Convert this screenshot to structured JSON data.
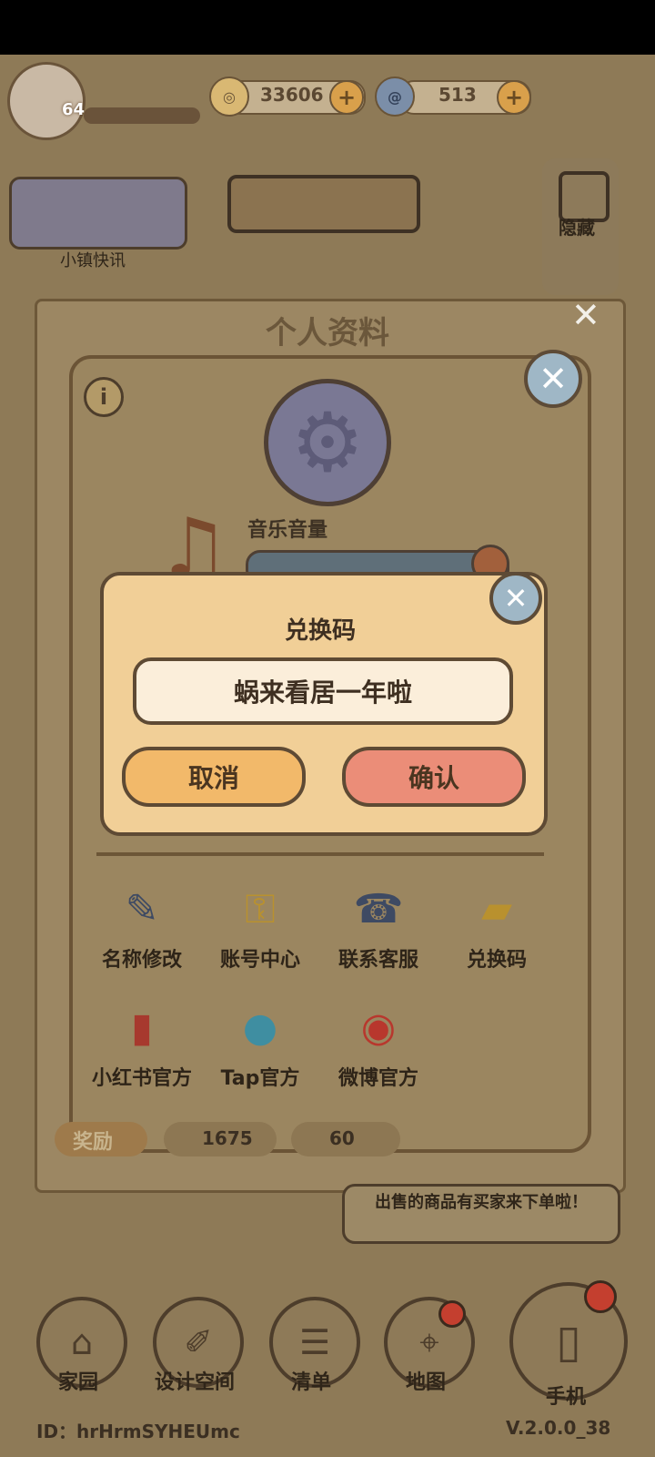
{
  "hud": {
    "level": "64",
    "coins": "33606",
    "gems": "513"
  },
  "side": {
    "news_label": "小镇快讯",
    "hide_label": "隐藏"
  },
  "profile": {
    "title": "个人资料",
    "music_label": "音乐音量",
    "menu": [
      {
        "label": "名称修改",
        "icon": "pencil-icon"
      },
      {
        "label": "账号中心",
        "icon": "key-icon"
      },
      {
        "label": "联系客服",
        "icon": "headset-icon"
      },
      {
        "label": "兑换码",
        "icon": "ticket-icon"
      },
      {
        "label": "小红书官方",
        "icon": "red-book-icon"
      },
      {
        "label": "Tap官方",
        "icon": "tap-icon"
      },
      {
        "label": "微博官方",
        "icon": "weibo-icon"
      }
    ],
    "reward_label": "奖励",
    "reward_coins": "1675",
    "reward_gems": "60"
  },
  "redeem": {
    "title": "兑换码",
    "code": "蜗来看居一年啦",
    "cancel": "取消",
    "confirm": "确认"
  },
  "toast": "出售的商品有买家来下单啦！",
  "nav": {
    "home": "家园",
    "design": "设计空间",
    "list": "清单",
    "map": "地图",
    "phone": "手机"
  },
  "footer": {
    "id": "ID：hrHrmSYHEUmc",
    "version": "V.2.0.0_38"
  },
  "colors": {
    "panel": "#9b8660",
    "dialog": "#f1cf97",
    "confirm": "#eb8d78",
    "cancel": "#f2b96a"
  }
}
